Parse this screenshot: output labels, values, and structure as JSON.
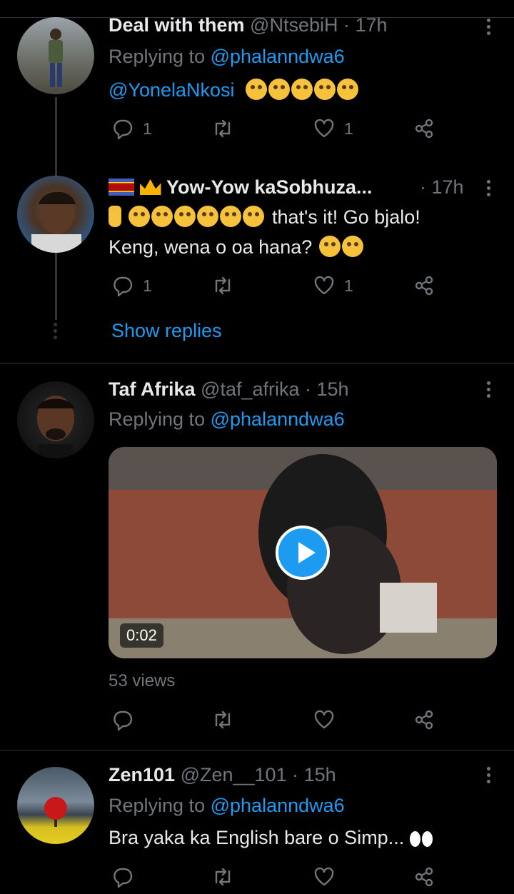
{
  "tweets": [
    {
      "name": "Deal with them",
      "handle": "@NtsebiH",
      "time": "· 17h",
      "replying_prefix": "Replying to",
      "replying_to": "@phalanndwa6",
      "mention": "@YonelaNkosi",
      "reply_count": "1",
      "like_count": "1"
    },
    {
      "name": "Yow-Yow kaSobhuza...",
      "time": "· 17h",
      "text_1": "that's it! Go bjalo!",
      "text_2": "Keng, wena o oa hana?",
      "reply_count": "1",
      "like_count": "1",
      "show_replies": "Show replies"
    },
    {
      "name": "Taf Afrika",
      "handle": "@taf_afrika",
      "time": "· 15h",
      "replying_prefix": "Replying to",
      "replying_to": "@phalanndwa6",
      "video_duration": "0:02",
      "views": "53 views"
    },
    {
      "name": "Zen101",
      "handle": "@Zen__101",
      "time": "· 15h",
      "replying_prefix": "Replying to",
      "replying_to": "@phalanndwa6",
      "text": "Bra yaka ka English bare o Simp..."
    }
  ],
  "colors": {
    "link": "#1d9bf0",
    "muted": "#71767b",
    "background": "#000000"
  }
}
